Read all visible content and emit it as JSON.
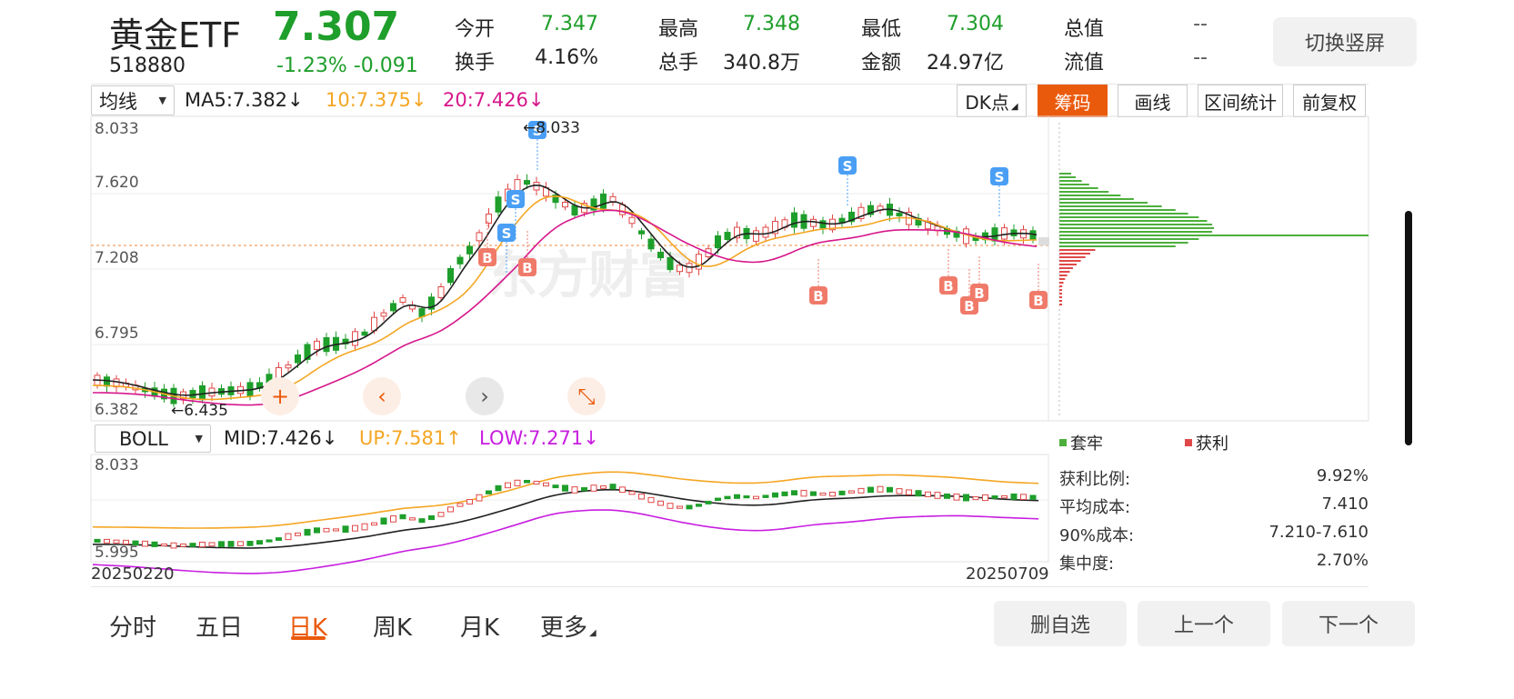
{
  "header": {
    "name": "黄金ETF",
    "price": "7.307",
    "code": "518880",
    "change": "-1.23% -0.091"
  },
  "quote": [
    {
      "label": "今开",
      "value": "7.347",
      "color": "#1e9e2a"
    },
    {
      "label": "最高",
      "value": "7.348",
      "color": "#1e9e2a"
    },
    {
      "label": "最低",
      "value": "7.304",
      "color": "#1e9e2a"
    },
    {
      "label": "总值",
      "value": "--",
      "color": "#333333"
    },
    {
      "label": "换手",
      "value": "4.16%",
      "color": "#333333"
    },
    {
      "label": "总手",
      "value": "340.8万",
      "color": "#333333"
    },
    {
      "label": "金额",
      "value": "24.97亿",
      "color": "#333333"
    },
    {
      "label": "流值",
      "value": "--",
      "color": "#333333"
    }
  ],
  "switch_button": "切换竖屏",
  "ma_bar": {
    "select": "均线",
    "ma5": "MA5:7.382",
    "ma10": "10:7.375",
    "ma20": "20:7.426",
    "arrow": "↓",
    "colors": {
      "ma5": "#222222",
      "ma10": "#f5a623",
      "ma20": "#d6168b"
    }
  },
  "toolbar": {
    "dk": "DK点",
    "chip": "筹码",
    "draw": "画线",
    "range": "区间统计",
    "adjust": "前复权"
  },
  "main_chart": {
    "y_ticks": [
      "8.033",
      "7.620",
      "7.208",
      "6.795",
      "6.382"
    ],
    "high_label": "8.033",
    "low_label": "6.435",
    "signal_sell": "S",
    "signal_buy": "B",
    "watermark": "东方财富"
  },
  "boll_bar": {
    "select": "BOLL",
    "mid": "MID:7.426",
    "mid_arrow": "↓",
    "up": "UP:7.581",
    "up_arrow": "↑",
    "low": "LOW:7.271",
    "low_arrow": "↓",
    "colors": {
      "mid": "#222222",
      "up": "#f5a623",
      "low": "#c81ee0"
    }
  },
  "sub_chart": {
    "y_ticks": [
      "8.033",
      "5.995"
    ],
    "date_start": "20250220",
    "date_end": "20250709"
  },
  "chip_legend": {
    "trapped": "套牢",
    "profit": "获利",
    "colors": {
      "trapped": "#4caf3c",
      "profit": "#e04848"
    }
  },
  "chip_stats": [
    {
      "label": "获利比例:",
      "value": "9.92%"
    },
    {
      "label": "平均成本:",
      "value": "7.410"
    },
    {
      "label": "90%成本:",
      "value": "7.210-7.610"
    },
    {
      "label": "集中度:",
      "value": "2.70%"
    }
  ],
  "bottom_tabs": [
    {
      "label": "分时",
      "active": false
    },
    {
      "label": "五日",
      "active": false
    },
    {
      "label": "日K",
      "active": true
    },
    {
      "label": "周K",
      "active": false
    },
    {
      "label": "月K",
      "active": false
    },
    {
      "label": "更多",
      "active": false
    }
  ],
  "bottom_buttons": {
    "remove": "删自选",
    "prev": "上一个",
    "next": "下一个"
  },
  "colors": {
    "up": "#e04848",
    "down": "#1e9e2a",
    "accent": "#ea5a0c",
    "sell_badge": "#4a9ff5",
    "buy_badge": "#f07a6a"
  }
}
